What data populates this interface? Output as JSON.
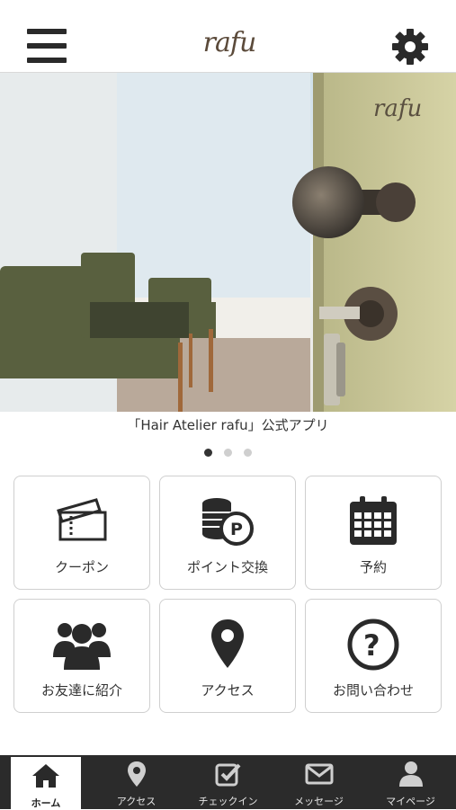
{
  "header": {
    "logo_text": "rafu",
    "menu_icon": "hamburger-menu-icon",
    "settings_icon": "gear-icon"
  },
  "hero": {
    "caption": "「Hair Atelier rafu」公式アプリ",
    "slide_count": 3,
    "active_slide": 1
  },
  "grid": [
    {
      "label": "クーポン",
      "icon": "coupon-ticket-icon"
    },
    {
      "label": "ポイント交換",
      "icon": "point-coins-icon"
    },
    {
      "label": "予約",
      "icon": "calendar-icon"
    },
    {
      "label": "お友達に紹介",
      "icon": "friends-group-icon"
    },
    {
      "label": "アクセス",
      "icon": "map-pin-icon"
    },
    {
      "label": "お問い合わせ",
      "icon": "question-icon"
    }
  ],
  "tabs": [
    {
      "label": "ホーム",
      "icon": "home-icon",
      "active": true
    },
    {
      "label": "アクセス",
      "icon": "map-pin-icon"
    },
    {
      "label": "チェックイン",
      "icon": "checkin-icon"
    },
    {
      "label": "メッセージ",
      "icon": "envelope-icon"
    },
    {
      "label": "マイページ",
      "icon": "user-icon"
    }
  ],
  "colors": {
    "tabbar_bg": "#2b2b2b",
    "icon_dark": "#2a2a2a",
    "logo": "#5b4a3a"
  }
}
